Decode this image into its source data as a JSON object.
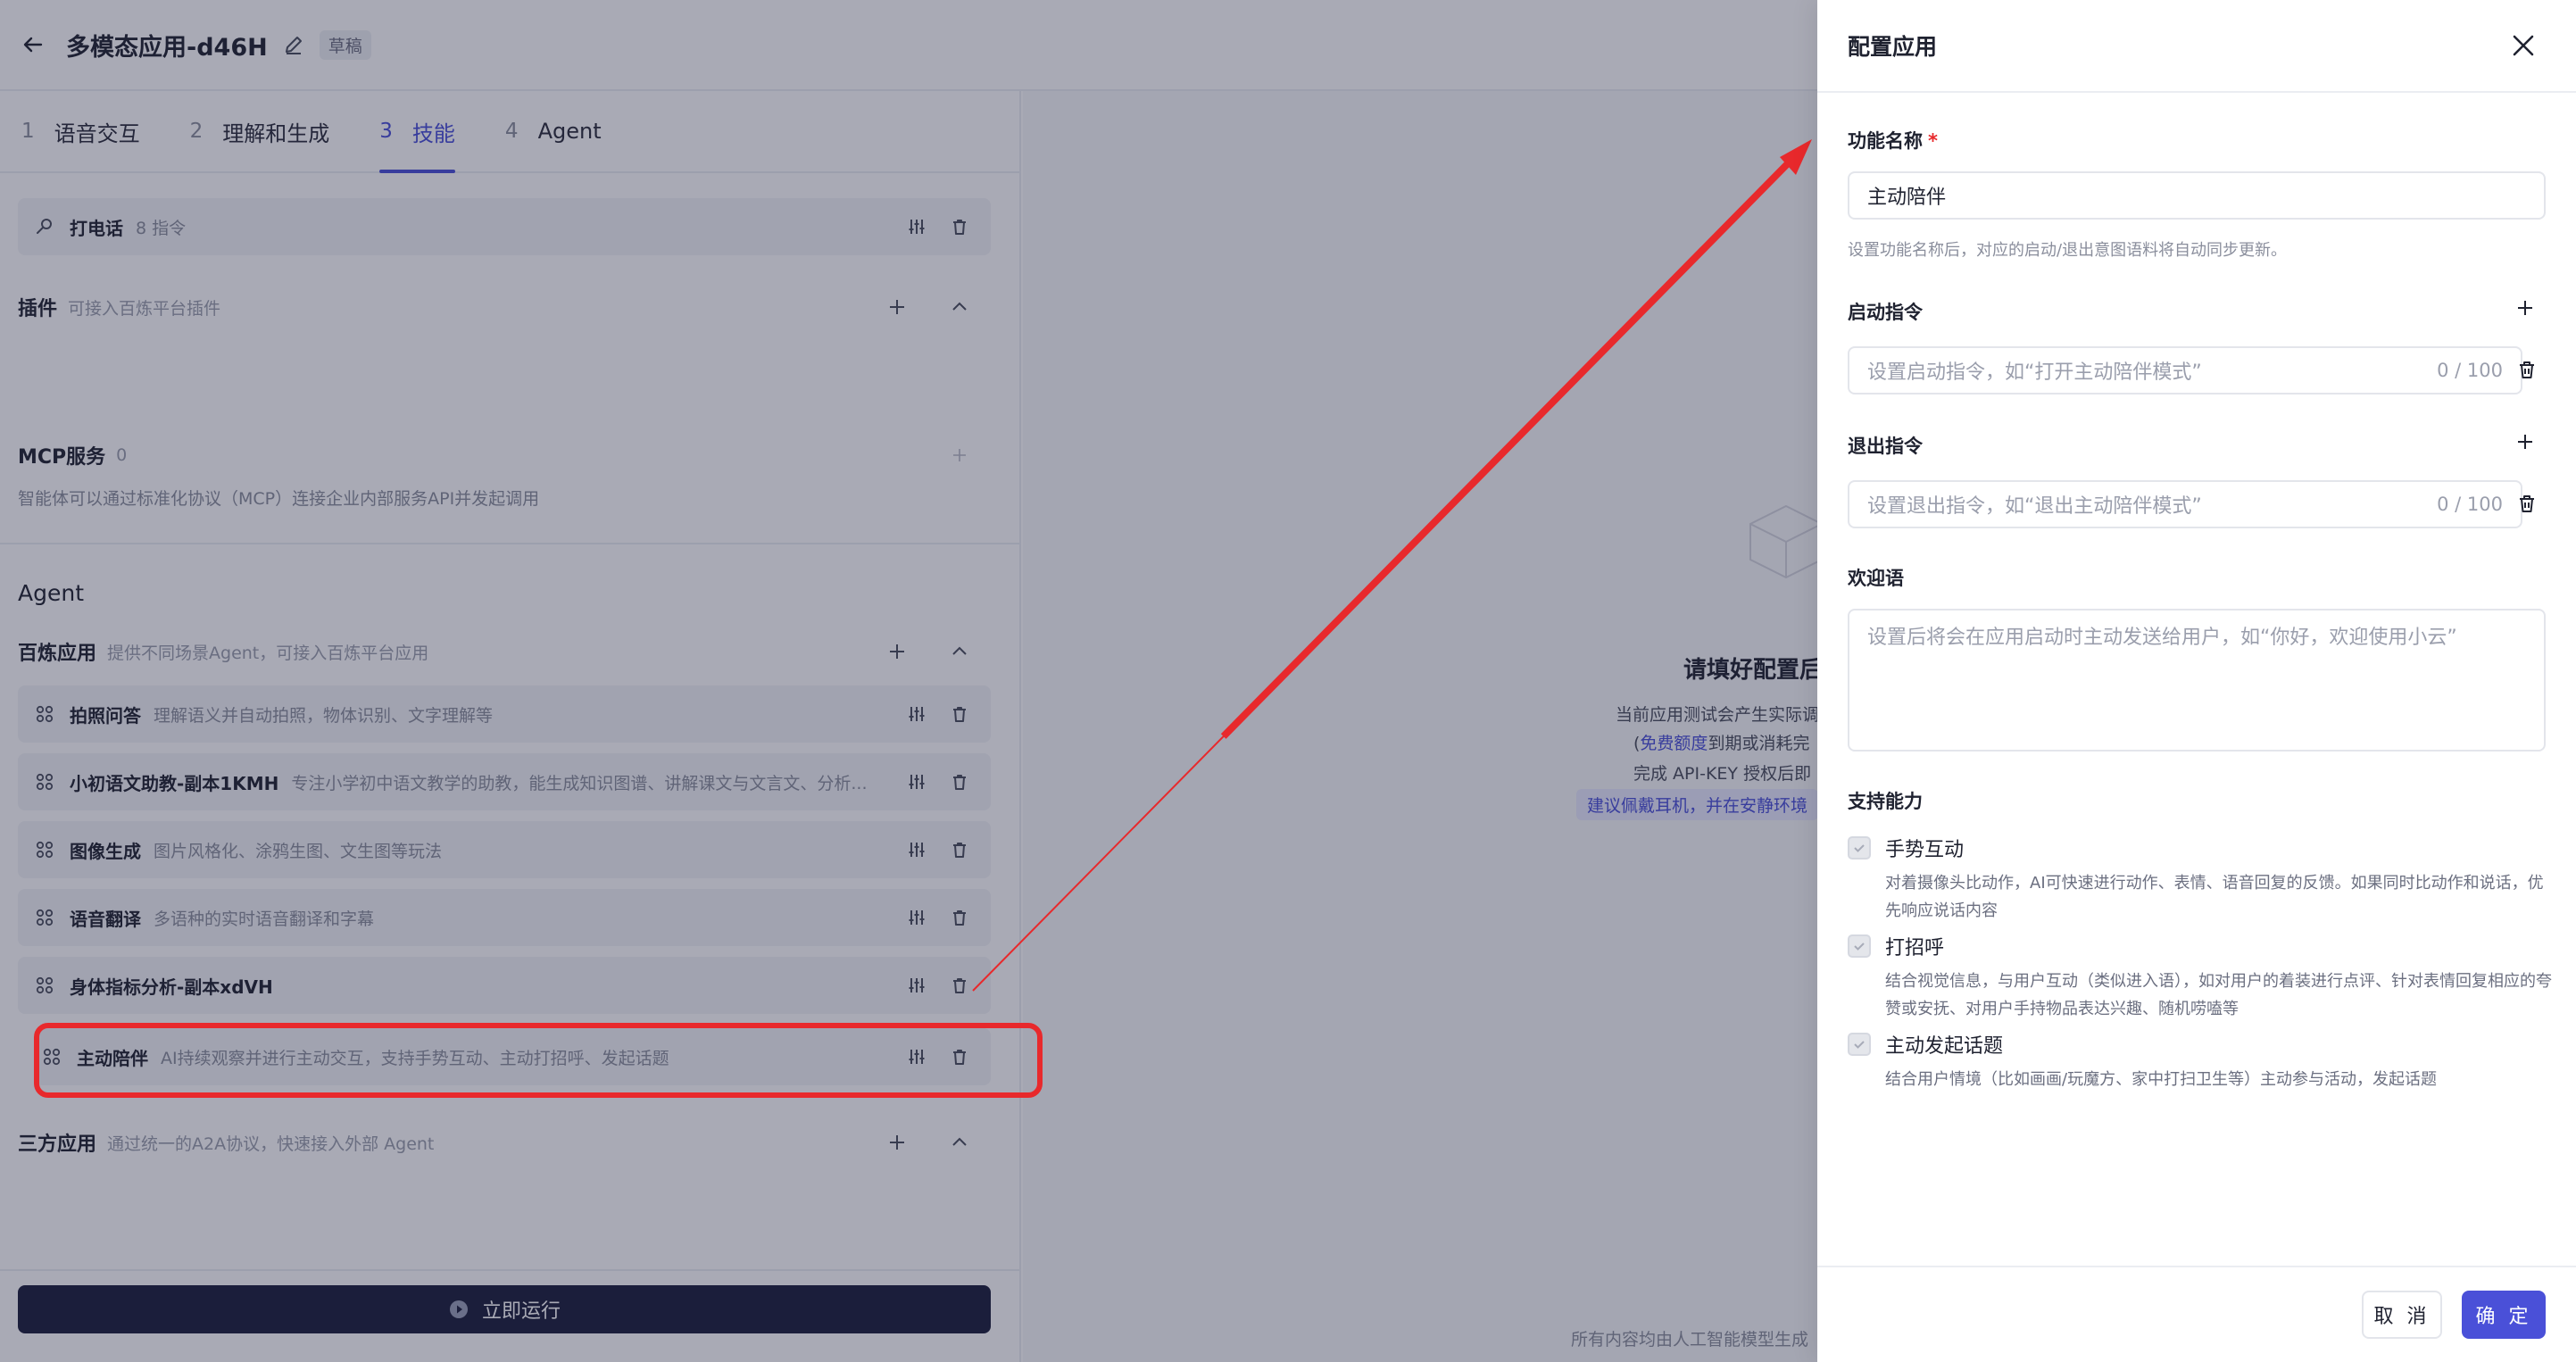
{
  "header": {
    "title": "多模态应用-d46H",
    "status_badge": "草稿"
  },
  "tabs": [
    {
      "num": "1",
      "label": "语音交互"
    },
    {
      "num": "2",
      "label": "理解和生成"
    },
    {
      "num": "3",
      "label": "技能"
    },
    {
      "num": "4",
      "label": "Agent"
    }
  ],
  "skills": {
    "phone": {
      "name": "打电话",
      "desc": "8 指令"
    },
    "plugins": {
      "title": "插件",
      "sub": "可接入百炼平台插件"
    },
    "mcp": {
      "title": "MCP服务",
      "count": "0",
      "desc": "智能体可以通过标准化协议（MCP）连接企业内部服务API并发起调用"
    }
  },
  "agent": {
    "heading": "Agent",
    "bailian": {
      "title": "百炼应用",
      "sub": "提供不同场景Agent，可接入百炼平台应用"
    },
    "apps": [
      {
        "name": "拍照问答",
        "desc": "理解语义并自动拍照，物体识别、文字理解等"
      },
      {
        "name": "小初语文助教-副本1KMH",
        "desc": "专注小学初中语文教学的助教，能生成知识图谱、讲解课文与文言文、分析..."
      },
      {
        "name": "图像生成",
        "desc": "图片风格化、涂鸦生图、文生图等玩法"
      },
      {
        "name": "语音翻译",
        "desc": "多语种的实时语音翻译和字幕"
      },
      {
        "name": "身体指标分析-副本xdVH",
        "desc": ""
      },
      {
        "name": "主动陪伴",
        "desc": "AI持续观察并进行主动交互，支持手势互动、主动打招呼、发起话题"
      }
    ],
    "third_party": {
      "title": "三方应用",
      "sub": "通过统一的A2A协议，快速接入外部 Agent"
    }
  },
  "run_button": "立即运行",
  "preview": {
    "title": "请填好配置后",
    "line1": "当前应用测试会产生实际调",
    "line2_prefix": "(",
    "line2_link": "免费额度",
    "line2_suffix": "到期或消耗完",
    "line3": "完成 API-KEY 授权后即",
    "tip": "建议佩戴耳机，并在安静环境",
    "footer": "所有内容均由人工智能模型生成"
  },
  "drawer": {
    "title": "配置应用",
    "name_label": "功能名称",
    "required_mark": "*",
    "name_value": "主动陪伴",
    "name_hint": "设置功能名称后，对应的启动/退出意图语料将自动同步更新。",
    "start_label": "启动指令",
    "start_placeholder": "设置启动指令，如“打开主动陪伴模式”",
    "start_counter": "0 / 100",
    "exit_label": "退出指令",
    "exit_placeholder": "设置退出指令，如“退出主动陪伴模式”",
    "exit_counter": "0 / 100",
    "welcome_label": "欢迎语",
    "welcome_placeholder": "设置后将会在应用启动时主动发送给用户，如“你好，欢迎使用小云”",
    "abilities_label": "支持能力",
    "abilities": [
      {
        "name": "手势互动",
        "desc": "对着摄像头比动作，AI可快速进行动作、表情、语音回复的反馈。如果同时比动作和说话，优先响应说话内容",
        "checked": true
      },
      {
        "name": "打招呼",
        "desc": "结合视觉信息，与用户互动（类似进入语），如对用户的着装进行点评、针对表情回复相应的夸赞或安抚、对用户手持物品表达兴趣、随机唠嗑等",
        "checked": true
      },
      {
        "name": "主动发起话题",
        "desc": "结合用户情境（比如画画/玩魔方、家中打扫卫生等）主动参与活动，发起话题",
        "checked": true
      }
    ],
    "cancel": "取 消",
    "ok": "确 定"
  },
  "colors": {
    "accent": "#4a50d8",
    "annotation_red": "#e8292c",
    "run_bar": "#1b1d3a"
  }
}
